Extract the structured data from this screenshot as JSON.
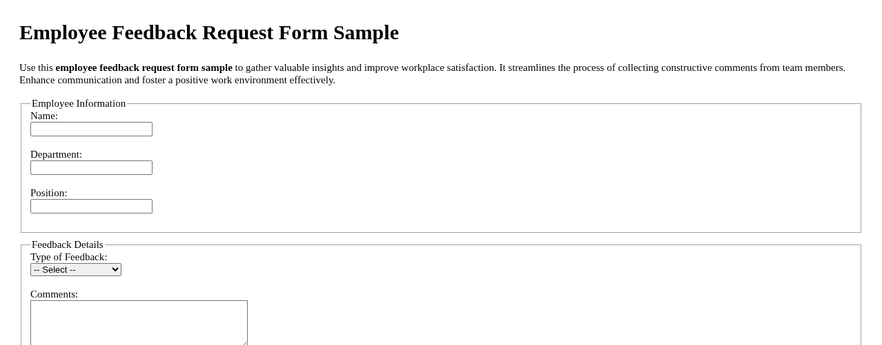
{
  "title": "Employee Feedback Request Form Sample",
  "intro": "Use this **employee feedback request form sample** to gather valuable insights and improve workplace satisfaction. It streamlines the process of collecting constructive comments from team members. Enhance communication and foster a positive work environment effectively.",
  "sections": [
    {
      "legend": "Employee Information",
      "fields": [
        {
          "kind": "text",
          "label": "Name:"
        },
        {
          "kind": "text",
          "label": "Department:"
        },
        {
          "kind": "text",
          "label": "Position:"
        }
      ]
    },
    {
      "legend": "Feedback Details",
      "fields": [
        {
          "kind": "select",
          "label": "Type of Feedback:",
          "value": "-- Select --"
        },
        {
          "kind": "textarea",
          "label": "Comments:"
        }
      ]
    }
  ]
}
